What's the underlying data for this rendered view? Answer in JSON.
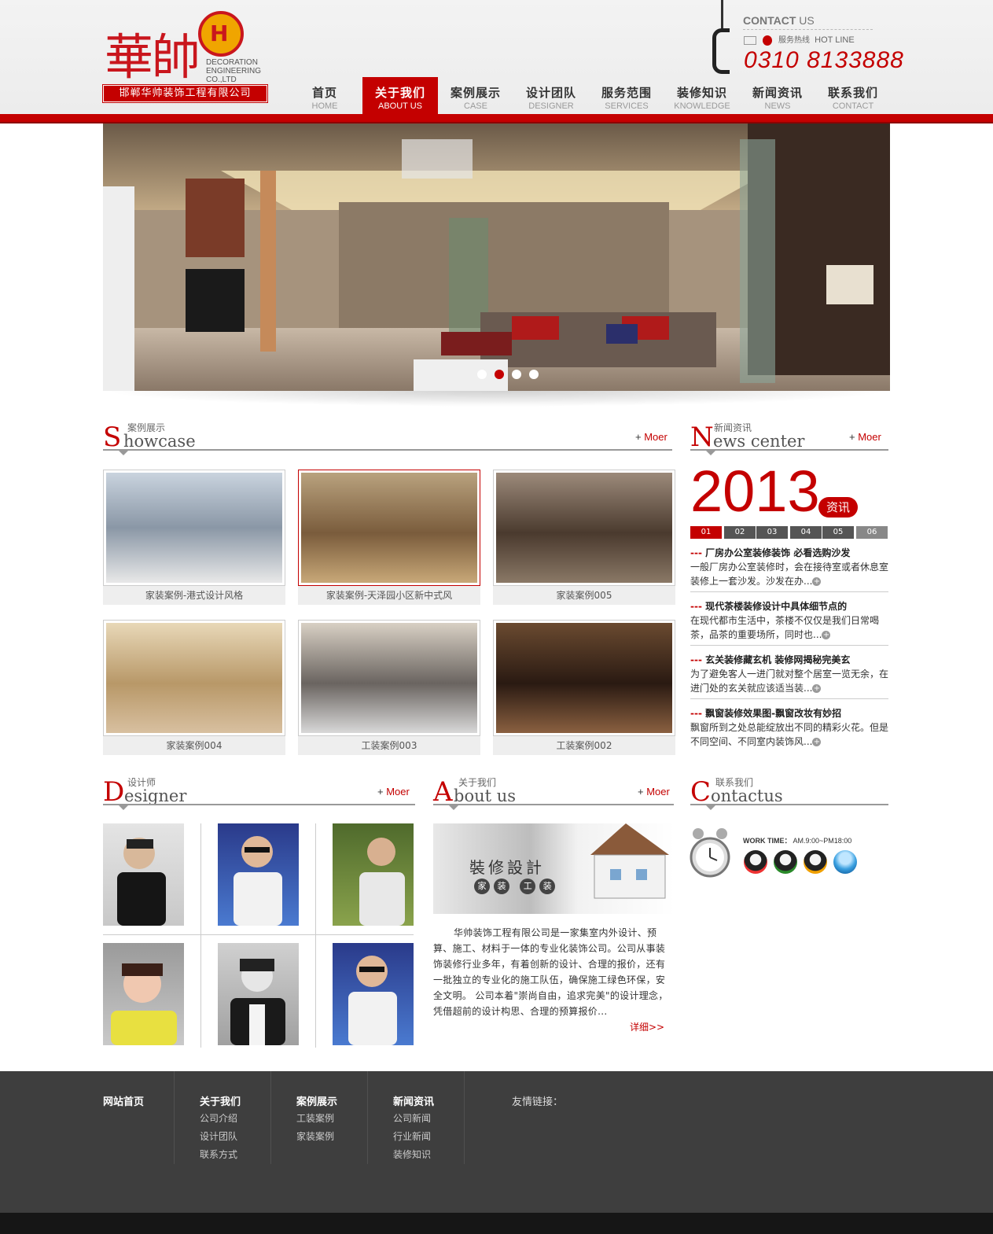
{
  "brand": {
    "logo_cn": "華帥",
    "logo_mark": "H",
    "logo_en_1": "DECORATION",
    "logo_en_2": "ENGINEERING",
    "logo_en_3": "CO.,LTD",
    "company": "邯郸华帅装饰工程有限公司"
  },
  "contact_header": {
    "title_bold": "CONTACT",
    "title_rest": " US",
    "hotline_cn": "服务热线",
    "hotline_en": "HOT LINE",
    "phone": "0310 8133888"
  },
  "nav": [
    {
      "cn": "首页",
      "en": "HOME"
    },
    {
      "cn": "关于我们",
      "en": "ABOUT US"
    },
    {
      "cn": "案例展示",
      "en": "CASE"
    },
    {
      "cn": "设计团队",
      "en": "DESIGNER"
    },
    {
      "cn": "服务范围",
      "en": "SERVICES"
    },
    {
      "cn": "装修知识",
      "en": "KNOWLEDGE"
    },
    {
      "cn": "新闻资讯",
      "en": "NEWS"
    },
    {
      "cn": "联系我们",
      "en": "CONTACT"
    }
  ],
  "nav_active_index": 1,
  "banner": {
    "slides": 4,
    "active_slide": 2
  },
  "showcase": {
    "small": "案例展示",
    "big": "S",
    "rest": "howcase",
    "more": "Moer",
    "items": [
      {
        "caption": "家装案例-港式设计风格"
      },
      {
        "caption": "家装案例-天泽园小区新中式风"
      },
      {
        "caption": "家装案例005"
      },
      {
        "caption": "家装案例004"
      },
      {
        "caption": "工装案例003"
      },
      {
        "caption": "工装案例002"
      }
    ]
  },
  "news": {
    "small": "新闻资讯",
    "big": "N",
    "rest": "ews center",
    "more": "Moer",
    "year": "2013",
    "badge": "资讯",
    "tabs": [
      "01",
      "02",
      "03",
      "04",
      "05",
      "06"
    ],
    "items": [
      {
        "title": "厂房办公室装修装饰 必看选购沙发",
        "desc": "一般厂房办公室装修时，会在接待室或者休息室装修上一套沙发。沙发在办..."
      },
      {
        "title": "现代茶楼装修设计中具体细节点的",
        "desc": "在现代都市生活中，茶楼不仅仅是我们日常喝茶，品茶的重要场所，同时也..."
      },
      {
        "title": "玄关装修藏玄机 装修网揭秘完美玄",
        "desc": "为了避免客人一进门就对整个居室一览无余，在进门处的玄关就应该适当装..."
      },
      {
        "title": "飘窗装修效果图-飘窗改妆有妙招",
        "desc": "飘窗所到之处总能绽放出不同的精彩火花。但是不同空间、不同室内装饰风..."
      }
    ],
    "dash": "---"
  },
  "designer": {
    "small": "设计师",
    "big": "D",
    "rest": "esigner",
    "more": "Moer"
  },
  "about": {
    "small": "关于我们",
    "big": "A",
    "rest": "bout us",
    "more": "Moer",
    "img_title": "裝修設計",
    "img_tags": [
      "家",
      "装",
      "工",
      "装"
    ],
    "text": "华帅装饰工程有限公司是一家集室内外设计、预算、施工、材料于一体的专业化装饰公司。公司从事装饰装修行业多年，有着创新的设计、合理的报价，还有一批独立的专业化的施工队伍，确保施工绿色环保，安全文明。 公司本着\"崇尚自由，追求完美\"的设计理念，凭借超前的设计构思、合理的预算报价...",
    "detail": "详细>>"
  },
  "contact": {
    "small": "联系我们",
    "big": "C",
    "rest": "ontactus",
    "work_label": "WORK TIME：",
    "work_time": "AM.9:00~PM18:00"
  },
  "footer": {
    "cols": [
      {
        "head": "网站首页",
        "links": []
      },
      {
        "head": "关于我们",
        "links": [
          "公司介绍",
          "设计团队",
          "联系方式"
        ]
      },
      {
        "head": "案例展示",
        "links": [
          "工装案例",
          "家装案例"
        ]
      },
      {
        "head": "新闻资讯",
        "links": [
          "公司新闻",
          "行业新闻",
          "装修知识"
        ]
      }
    ],
    "friend_links": "友情链接："
  },
  "colors": {
    "accent": "#c40000",
    "footer": "#3e3e3e"
  }
}
